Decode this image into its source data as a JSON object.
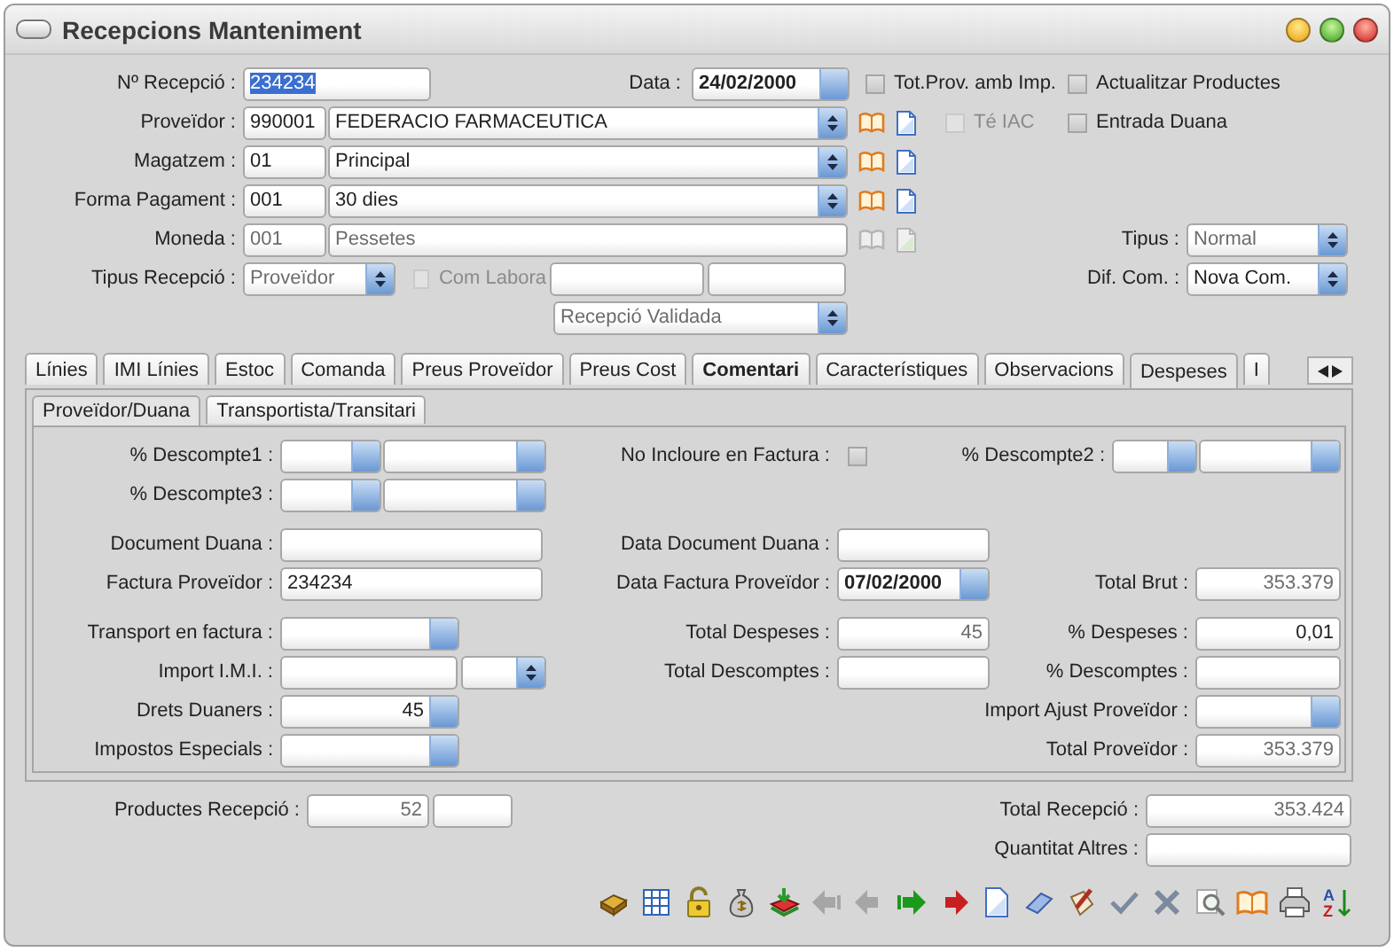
{
  "window": {
    "title": "Recepcions Manteniment"
  },
  "header": {
    "reception_number": {
      "label": "Nº Recepció :",
      "value": "234234",
      "text_selected": true
    },
    "date": {
      "label": "Data :",
      "value": "24/02/2000"
    },
    "options": [
      {
        "label": "Tot.Prov. amb Imp.",
        "checked": false,
        "disabled": false
      },
      {
        "label": "Actualitzar Productes",
        "checked": false,
        "disabled": false
      },
      {
        "label": "Té IAC",
        "checked": false,
        "disabled": true
      },
      {
        "label": "Entrada Duana",
        "checked": false,
        "disabled": false
      }
    ],
    "lookups": [
      {
        "label": "Proveïdor :",
        "code": "990001",
        "name": "FEDERACIO FARMACEUTICA",
        "disabled": false
      },
      {
        "label": "Magatzem :",
        "code": "01",
        "name": "Principal",
        "disabled": false
      },
      {
        "label": "Forma Pagament :",
        "code": "001",
        "name": "30 dies",
        "disabled": false
      },
      {
        "label": "Moneda :",
        "code": "001",
        "name": "Pessetes",
        "disabled": true
      }
    ],
    "tipus": {
      "label": "Tipus :",
      "value": "Normal",
      "disabled": true
    },
    "tipus_recepcio": {
      "label": "Tipus Recepció :",
      "value": "Proveïdor"
    },
    "com_labora": {
      "label": "Com Labora",
      "checked": false,
      "disabled": true
    },
    "dif_com": {
      "label": "Dif. Com. :",
      "value": "Nova Com."
    },
    "estat": {
      "value": "Recepció Validada"
    }
  },
  "tabs": [
    {
      "label": "Línies",
      "selected": false,
      "bold": false
    },
    {
      "label": "IMI Línies",
      "selected": false,
      "bold": false
    },
    {
      "label": "Estoc",
      "selected": false,
      "bold": false
    },
    {
      "label": "Comanda",
      "selected": false,
      "bold": false
    },
    {
      "label": "Preus Proveïdor",
      "selected": false,
      "bold": false
    },
    {
      "label": "Preus Cost",
      "selected": false,
      "bold": false
    },
    {
      "label": "Comentari",
      "selected": false,
      "bold": true
    },
    {
      "label": "Característiques",
      "selected": false,
      "bold": false
    },
    {
      "label": "Observacions",
      "selected": false,
      "bold": false
    },
    {
      "label": "Despeses",
      "selected": true,
      "bold": false
    },
    {
      "label": "I",
      "selected": false,
      "bold": false
    }
  ],
  "subtabs": [
    {
      "label": "Proveïdor/Duana",
      "selected": true
    },
    {
      "label": "Transportista/Transitari",
      "selected": false
    }
  ],
  "sections": [
    {
      "rows": [
        {
          "left": {
            "label": "% Descompte1 :",
            "kind": "double_spin"
          },
          "middle": {
            "label": "No Incloure en Factura :",
            "kind": "checkbox",
            "checked": false
          },
          "right": {
            "label": "% Descompte2 :",
            "kind": "double_spin"
          }
        },
        {
          "left": {
            "label": "% Descompte3 :",
            "kind": "double_spin"
          }
        }
      ]
    },
    {
      "rows": [
        {
          "left": {
            "label": "Document Duana :",
            "kind": "text"
          },
          "middle": {
            "label": "Data Document Duana :",
            "kind": "text"
          }
        },
        {
          "left": {
            "label": "Factura Proveïdor :",
            "kind": "text",
            "value": "234234"
          },
          "middle": {
            "label": "Data Factura Proveïdor :",
            "kind": "date",
            "value": "07/02/2000"
          },
          "right": {
            "label": "Total Brut :",
            "kind": "number",
            "value": "353.379",
            "readonly": true
          }
        }
      ]
    },
    {
      "rows": [
        {
          "left": {
            "label": "Transport en factura :",
            "kind": "spin"
          },
          "middle": {
            "label": "Total Despeses :",
            "kind": "number",
            "value": "45",
            "readonly": true
          },
          "right": {
            "label": "% Despeses :",
            "kind": "number",
            "value": "0,01",
            "readonly": false
          }
        },
        {
          "left": {
            "label": "Import I.M.I. :",
            "kind": "text_select"
          },
          "middle": {
            "label": "Total Descomptes :",
            "kind": "number"
          },
          "right": {
            "label": "% Descomptes :",
            "kind": "number"
          }
        },
        {
          "left": {
            "label": "Drets Duaners :",
            "kind": "spin",
            "value": "45"
          },
          "right": {
            "label": "Import Ajust Proveïdor :",
            "kind": "spin"
          }
        },
        {
          "left": {
            "label": "Impostos Especials :",
            "kind": "spin"
          },
          "right": {
            "label": "Total Proveïdor :",
            "kind": "number",
            "value": "353.379",
            "readonly": true
          }
        }
      ]
    }
  ],
  "footer": {
    "productes": {
      "label": "Productes Recepció :",
      "value": "52"
    },
    "total": {
      "label": "Total Recepció :",
      "value": "353.424"
    },
    "quantitat": {
      "label": "Quantitat Altres :"
    }
  },
  "toolbar": [
    {
      "kind": "cashbox",
      "disabled": false
    },
    {
      "kind": "grid",
      "disabled": false
    },
    {
      "kind": "padlock",
      "disabled": false
    },
    {
      "kind": "moneybag",
      "disabled": false
    },
    {
      "kind": "import",
      "disabled": false
    },
    {
      "kind": "first",
      "disabled": true
    },
    {
      "kind": "previous",
      "disabled": true
    },
    {
      "kind": "next",
      "disabled": false
    },
    {
      "kind": "last",
      "disabled": false
    },
    {
      "kind": "new",
      "disabled": false
    },
    {
      "kind": "eraser",
      "disabled": false
    },
    {
      "kind": "brush",
      "disabled": false
    },
    {
      "kind": "accept",
      "disabled": false
    },
    {
      "kind": "cancel",
      "disabled": false
    },
    {
      "kind": "search",
      "disabled": false
    },
    {
      "kind": "book",
      "disabled": false
    },
    {
      "kind": "print",
      "disabled": false
    },
    {
      "kind": "sort",
      "disabled": false,
      "top": "A",
      "bottom": "Z"
    }
  ]
}
